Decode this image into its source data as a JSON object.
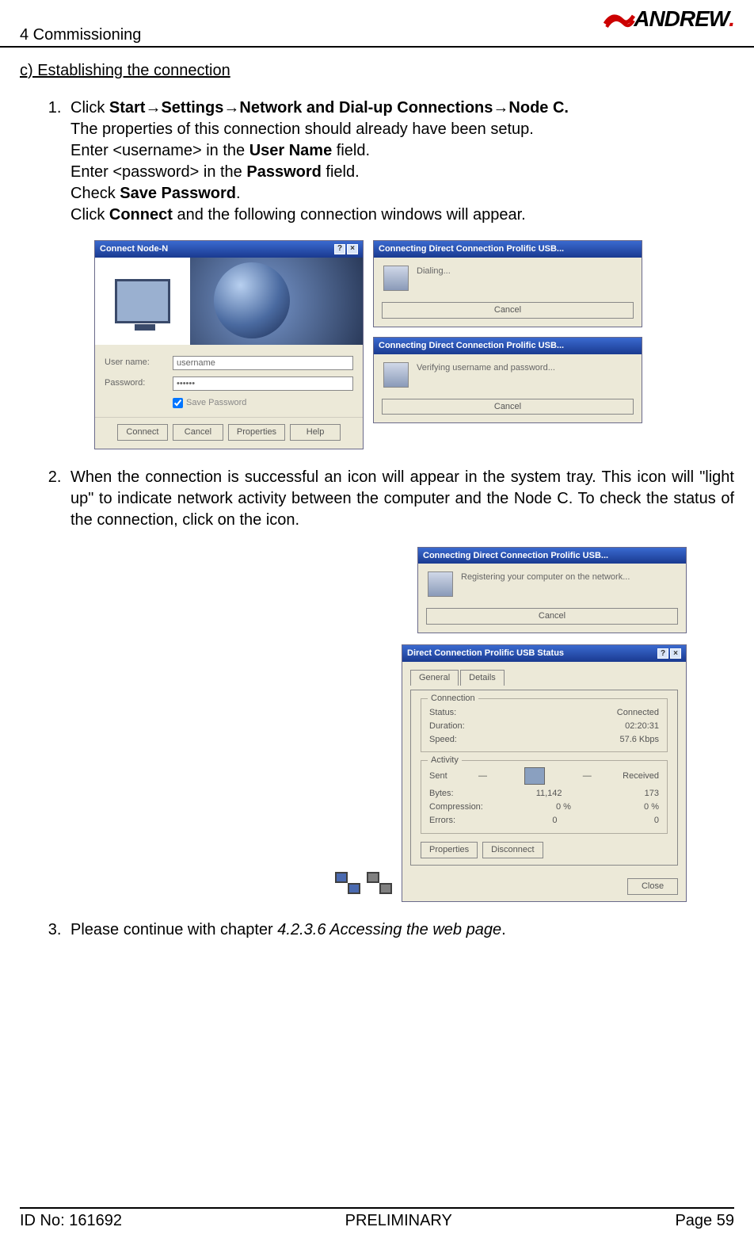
{
  "header": {
    "chapter": "4 Commissioning",
    "brand": "ANDREW",
    "brand_dot": "."
  },
  "section_title": "c) Establishing the connection",
  "step1": {
    "click": "Click ",
    "path_start": "Start",
    "arrow": "→",
    "path_settings": "Settings",
    "path_net": "Network and Dial-up Connections",
    "path_node": "Node C.",
    "l2": "The properties of this connection should already have been setup.",
    "l3a": "Enter <username> in the ",
    "l3b": "User Name",
    "l3c": " field.",
    "l4a": "Enter <password> in the ",
    "l4b": "Password",
    "l4c": " field.",
    "l5a": "Check ",
    "l5b": "Save Password",
    "l5c": ".",
    "l6a": "Click ",
    "l6b": "Connect",
    "l6c": " and the following connection windows will appear."
  },
  "win_connect": {
    "title": "Connect Node-N",
    "lbl_user": "User name:",
    "lbl_pass": "Password:",
    "val_user": "username",
    "chk": "Save Password",
    "btn_connect": "Connect",
    "btn_cancel": "Cancel",
    "btn_props": "Properties",
    "btn_help": "Help"
  },
  "win_dialing": {
    "title": "Connecting Direct Connection Prolific USB...",
    "text": "Dialing...",
    "btn": "Cancel"
  },
  "win_verify": {
    "title": "Connecting Direct Connection Prolific USB...",
    "text": "Verifying username and password...",
    "btn": "Cancel"
  },
  "step2": "When the connection is successful an icon will appear in the system tray. This icon will \"light up\" to indicate network activity between the computer and the Node C. To check the status of the connection, click on the icon.",
  "win_register": {
    "title": "Connecting Direct Connection Prolific USB...",
    "text": "Registering your computer on the network...",
    "btn": "Cancel"
  },
  "win_status": {
    "title": "Direct Connection Prolific USB Status",
    "tab_general": "General",
    "tab_details": "Details",
    "grp_conn": "Connection",
    "lbl_status": "Status:",
    "val_status": "Connected",
    "lbl_duration": "Duration:",
    "val_duration": "02:20:31",
    "lbl_speed": "Speed:",
    "val_speed": "57.6 Kbps",
    "grp_act": "Activity",
    "lbl_sent": "Sent",
    "lbl_recv": "Received",
    "lbl_bytes": "Bytes:",
    "val_bytes_s": "11,142",
    "val_bytes_r": "173",
    "lbl_comp": "Compression:",
    "val_comp_s": "0 %",
    "val_comp_r": "0 %",
    "lbl_err": "Errors:",
    "val_err_s": "0",
    "val_err_r": "0",
    "btn_props": "Properties",
    "btn_disc": "Disconnect",
    "btn_close": "Close"
  },
  "step3": {
    "a": "Please continue with chapter ",
    "b": "4.2.3.6 Accessing the web page",
    "c": "."
  },
  "footer": {
    "id": "ID No: 161692",
    "status": "PRELIMINARY",
    "page": "Page 59"
  }
}
